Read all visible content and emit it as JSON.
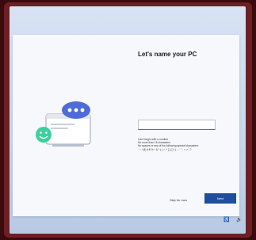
{
  "setup": {
    "title": "Let's name your PC",
    "description": "",
    "input_value": "",
    "rules": [
      "Can't begin with a number",
      "No more than 15 characters",
      "No spaces or any of the following special characters:",
      "` ~ ! @ # $ % ^ & * ( ) = + [ ] { } \\ | ; : ' \" , < > / ?"
    ],
    "skip_label": "Skip for now",
    "next_label": "Next"
  },
  "icons": {
    "illustration": "pc-name-illustration",
    "accessibility": "accessibility-icon",
    "volume": "volume-icon"
  },
  "colors": {
    "accent": "#1f4e9d",
    "chat_bubble": "#4f6bd8",
    "smiley": "#3fcf9e"
  }
}
